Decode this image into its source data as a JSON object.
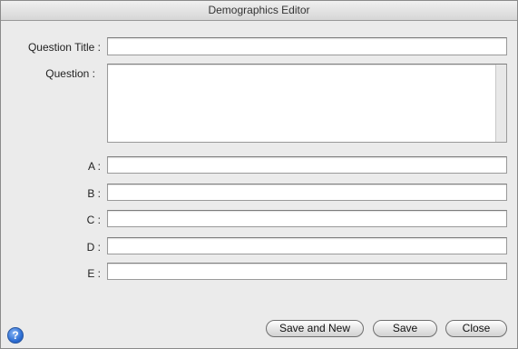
{
  "window": {
    "title": "Demographics Editor"
  },
  "form": {
    "question_title_label": "Question Title :",
    "question_title_value": "",
    "question_label": "Question :",
    "question_value": "",
    "options": [
      {
        "label": "A :",
        "value": ""
      },
      {
        "label": "B :",
        "value": ""
      },
      {
        "label": "C :",
        "value": ""
      },
      {
        "label": "D :",
        "value": ""
      },
      {
        "label": "E :",
        "value": ""
      }
    ]
  },
  "buttons": {
    "save_and_new": "Save and New",
    "save": "Save",
    "close": "Close",
    "help": "?"
  },
  "icons": {
    "help": "help-question-icon"
  }
}
